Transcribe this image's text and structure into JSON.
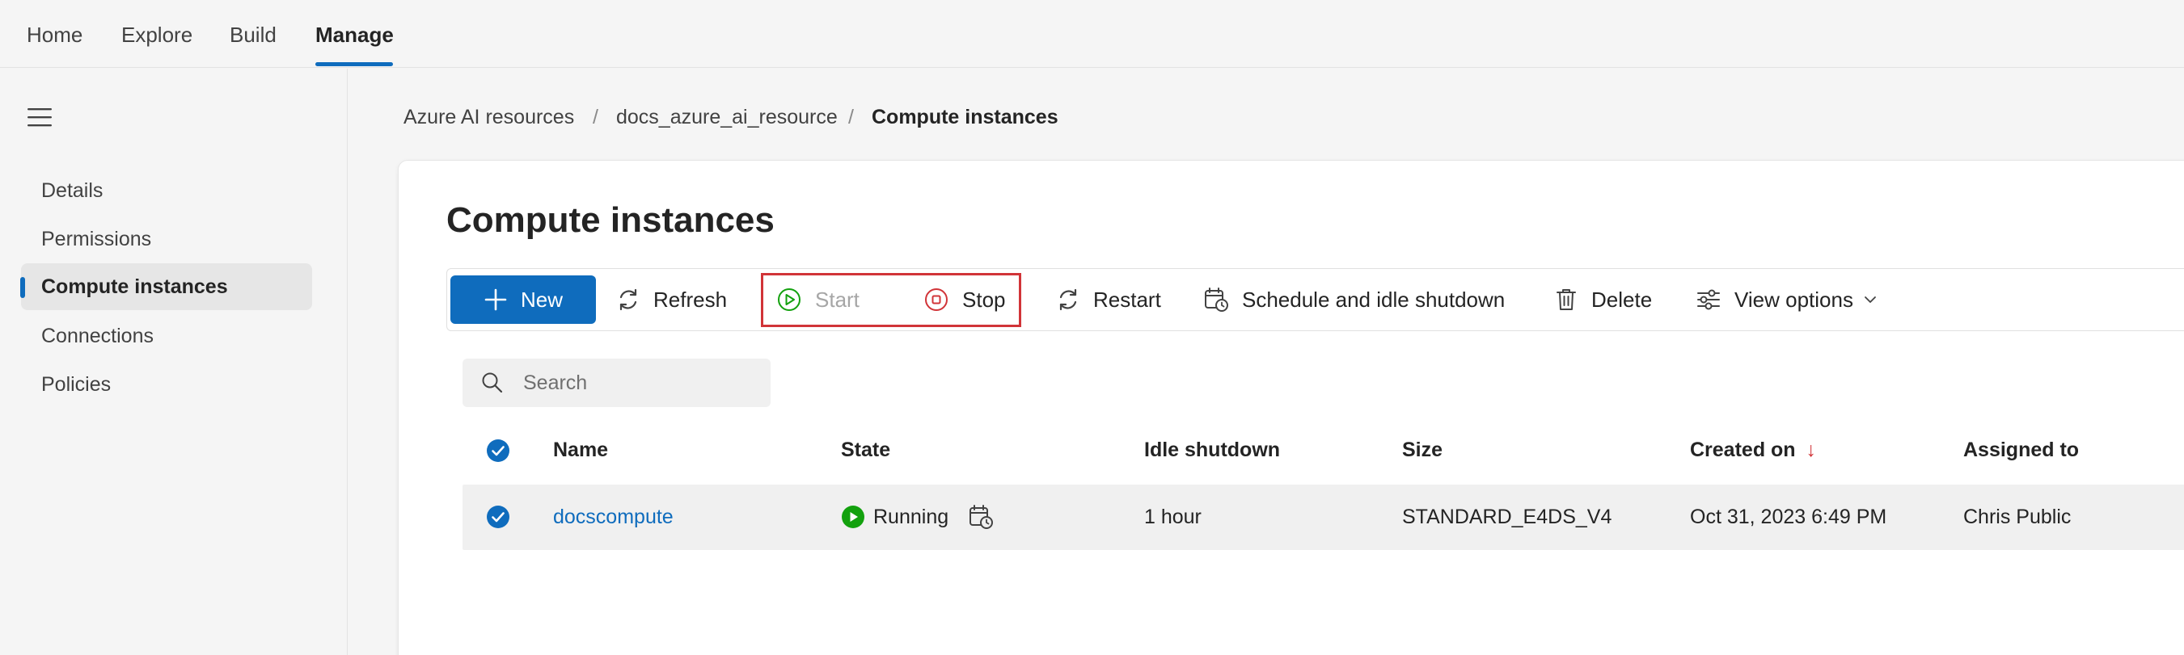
{
  "top_nav": {
    "tabs": [
      "Home",
      "Explore",
      "Build",
      "Manage"
    ],
    "active": "Manage"
  },
  "sidebar": {
    "items": [
      {
        "label": "Details"
      },
      {
        "label": "Permissions"
      },
      {
        "label": "Compute instances",
        "selected": true
      },
      {
        "label": "Connections"
      },
      {
        "label": "Policies"
      }
    ]
  },
  "breadcrumb": [
    "Azure AI resources",
    "docs_azure_ai_resource",
    "Compute instances"
  ],
  "page": {
    "title": "Compute instances"
  },
  "toolbar": {
    "new": "New",
    "refresh": "Refresh",
    "start": "Start",
    "stop": "Stop",
    "restart": "Restart",
    "schedule": "Schedule and idle shutdown",
    "delete": "Delete",
    "view_options": "View options"
  },
  "search": {
    "placeholder": "Search",
    "value": ""
  },
  "table": {
    "columns": [
      "Name",
      "State",
      "Idle shutdown",
      "Size",
      "Created on",
      "Assigned to"
    ],
    "sort_indicator": "↓",
    "rows": [
      {
        "name": "docscompute",
        "state": "Running",
        "idle_shutdown": "1 hour",
        "size": "STANDARD_E4DS_V4",
        "created_on": "Oct 31, 2023 6:49 PM",
        "assigned_to": "Chris Public",
        "selected": true
      }
    ]
  },
  "colors": {
    "accent": "#0f6cbd",
    "running": "#13a10e",
    "stop": "#d13438",
    "highlight_border": "#d13438"
  }
}
